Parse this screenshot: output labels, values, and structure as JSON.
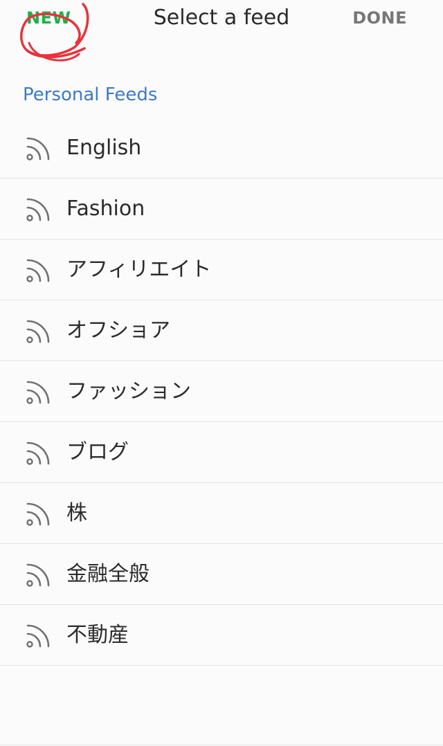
{
  "header": {
    "new_label": "NEW",
    "title": "Select a feed",
    "done_label": "DONE"
  },
  "section": {
    "title": "Personal Feeds"
  },
  "feeds": [
    {
      "label": "English",
      "icon": "rss-icon"
    },
    {
      "label": "Fashion",
      "icon": "rss-icon"
    },
    {
      "label": "アフィリエイト",
      "icon": "rss-icon"
    },
    {
      "label": "オフショア",
      "icon": "rss-icon"
    },
    {
      "label": "ファッション",
      "icon": "rss-icon"
    },
    {
      "label": "ブログ",
      "icon": "rss-icon"
    },
    {
      "label": "株",
      "icon": "rss-icon"
    },
    {
      "label": "金融全般",
      "icon": "rss-icon"
    },
    {
      "label": "不動産",
      "icon": "rss-icon"
    }
  ],
  "colors": {
    "new": "#21b04b",
    "done": "#777777",
    "section": "#3c7ac6",
    "annotation": "#e8323c",
    "icon": "#707070"
  }
}
